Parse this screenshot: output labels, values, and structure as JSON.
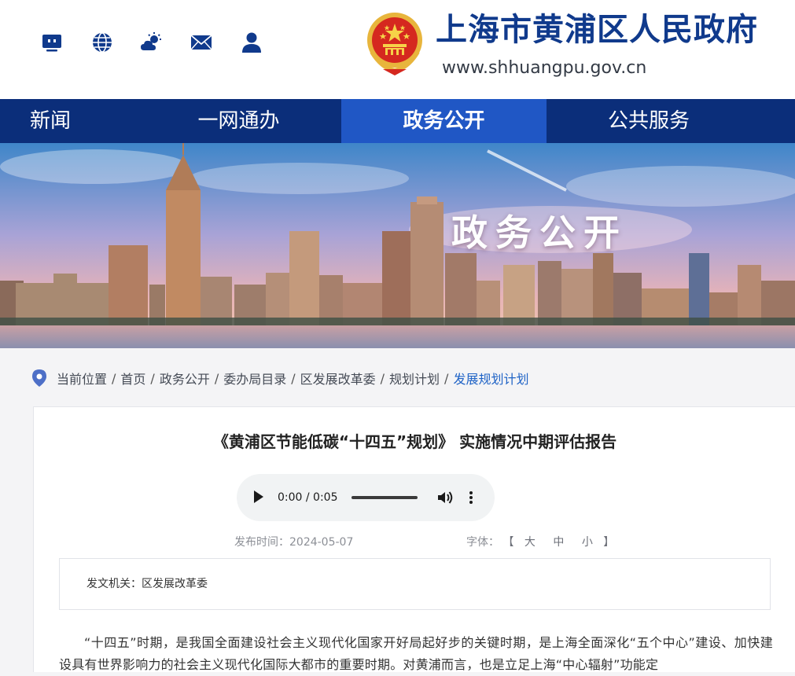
{
  "header": {
    "site_title": "上海市黄浦区人民政府",
    "site_url": "www.shhuangpu.gov.cn",
    "tool_icons": [
      "tv-icon",
      "globe-icon",
      "weather-icon",
      "mail-icon",
      "user-icon"
    ],
    "brand_color": "#103a8c"
  },
  "nav": {
    "items": [
      {
        "label": "新闻"
      },
      {
        "label": "一网通办"
      },
      {
        "label": "政务公开"
      },
      {
        "label": "公共服务"
      }
    ],
    "active": "政务公开",
    "background": "#0b2e7a",
    "active_background": "#2057c5"
  },
  "banner": {
    "title": "政务公开"
  },
  "breadcrumb": {
    "prefix": "当前位置",
    "items": [
      "首页",
      "政务公开",
      "委办局目录",
      "区发展改革委",
      "规划计划",
      "发展规划计划"
    ],
    "separator": "/"
  },
  "article": {
    "title": "《黄浦区节能低碳“十四五”规划》 实施情况中期评估报告",
    "audio": {
      "time": "0:00 / 0:05"
    },
    "publish_date_label": "发布时间：",
    "publish_date": "2024-05-07",
    "font_label": "字体：",
    "font_bracket_open": "【",
    "font_sizes": [
      "大",
      "中",
      "小"
    ],
    "font_bracket_close": "】",
    "issuer_label": "发文机关：",
    "issuer": "区发展改革委",
    "body": "“十四五”时期，是我国全面建设社会主义现代化国家开好局起好步的关键时期，是上海全面深化“五个中心”建设、加快建设具有世界影响力的社会主义现代化国际大都市的重要时期。对黄浦而言，也是立足上海“中心辐射”功能定"
  }
}
